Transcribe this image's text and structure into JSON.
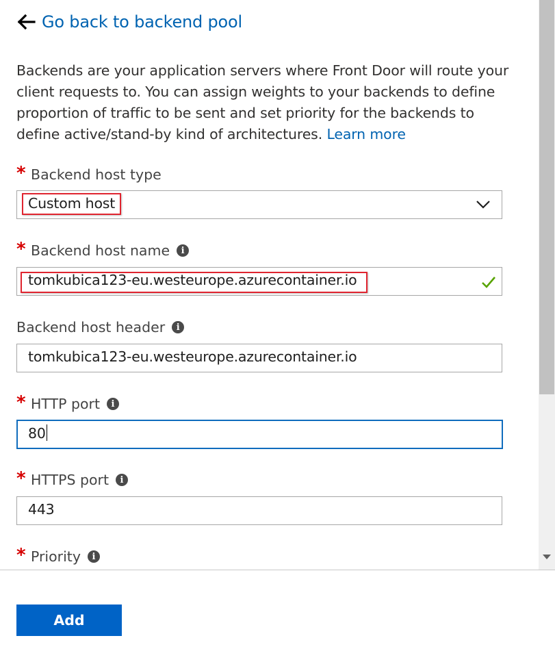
{
  "back": {
    "label": "Go back to backend pool",
    "icon": "arrow-left-icon"
  },
  "description": {
    "text": "Backends are your application servers where Front Door will route your client requests to. You can assign weights to your backends to define proportion of traffic to be sent and set priority for the backends to define active/stand-by kind of architectures.",
    "link": "Learn more"
  },
  "fields": {
    "host_type": {
      "label": "Backend host type",
      "required": true,
      "value": "Custom host"
    },
    "host_name": {
      "label": "Backend host name",
      "required": true,
      "value": "tomkubica123-eu.westeurope.azurecontainer.io",
      "valid": true
    },
    "host_header": {
      "label": "Backend host header",
      "required": false,
      "value": "tomkubica123-eu.westeurope.azurecontainer.io"
    },
    "http_port": {
      "label": "HTTP port",
      "required": true,
      "value": "80"
    },
    "https_port": {
      "label": "HTTPS port",
      "required": true,
      "value": "443"
    },
    "priority": {
      "label": "Priority",
      "required": true
    }
  },
  "required_mark": "*",
  "info_glyph": "i",
  "footer": {
    "add_label": "Add"
  },
  "colors": {
    "link": "#0063b1",
    "required": "#d60000",
    "highlight": "#e0242f",
    "primary_button": "#0063c6",
    "valid_check": "#57a300",
    "focus": "#0f6cbd"
  }
}
